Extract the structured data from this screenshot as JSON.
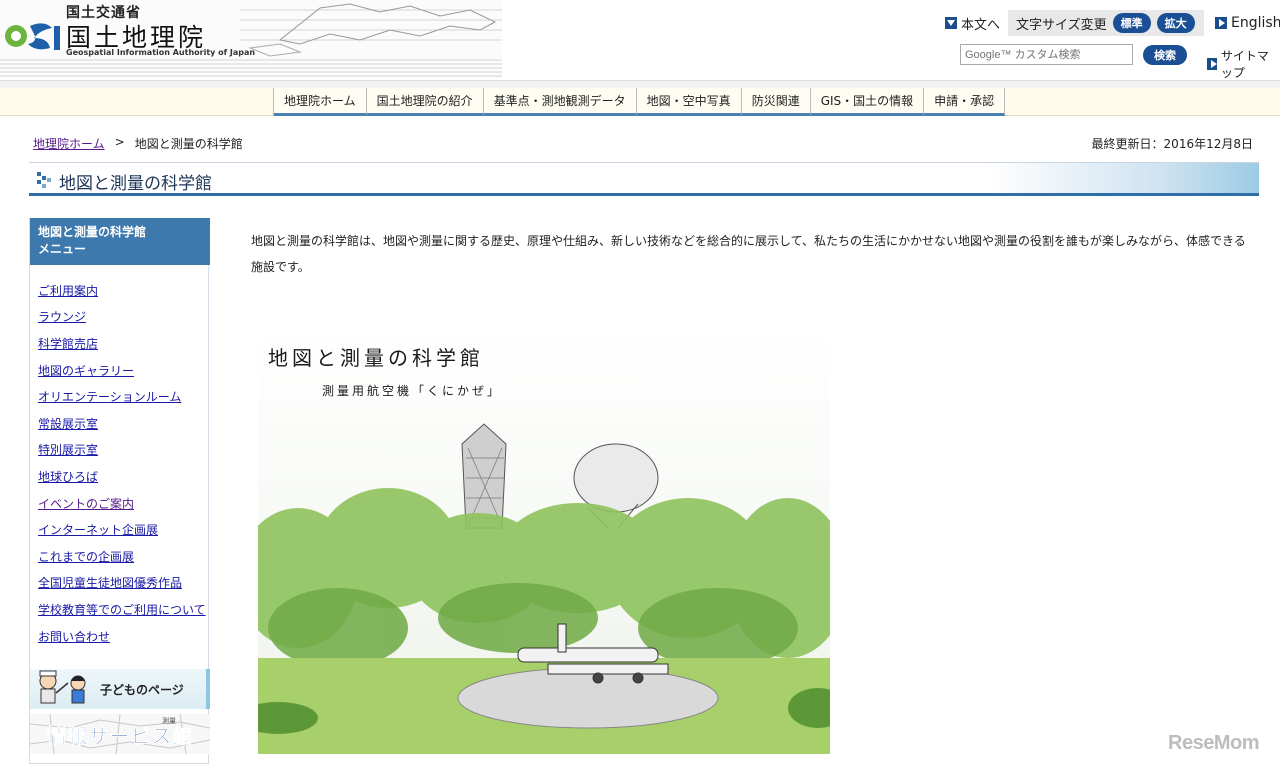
{
  "header": {
    "ministry": "国土交通省",
    "org_name": "国土地理院",
    "org_name_en": "Geospatial Information Authority of Japan",
    "skip_link": "本文へ",
    "font_size_label": "文字サイズ変更",
    "font_standard": "標準",
    "font_large": "拡大",
    "english": "English",
    "search_placeholder": "Google™ カスタム検索",
    "search_button": "検索",
    "sitemap": "サイトマップ"
  },
  "global_nav": [
    {
      "label": "地理院ホーム"
    },
    {
      "label": "国土地理院の紹介"
    },
    {
      "label": "基準点・測地観測データ"
    },
    {
      "label": "地図・空中写真"
    },
    {
      "label": "防災関連"
    },
    {
      "label": "GIS・国土の情報"
    },
    {
      "label": "申請・承認"
    }
  ],
  "breadcrumb": {
    "home": "地理院ホーム",
    "separator": ">",
    "current": "地図と測量の科学館"
  },
  "updated": "最終更新日：2016年12月8日",
  "page_title": "地図と測量の科学館",
  "sidebar": {
    "title": "地図と測量の科学館",
    "subtitle": "メニュー",
    "items": [
      {
        "label": "ご利用案内"
      },
      {
        "label": "ラウンジ"
      },
      {
        "label": "科学館売店"
      },
      {
        "label": "地図のギャラリー"
      },
      {
        "label": "オリエンテーションルーム"
      },
      {
        "label": "常設展示室"
      },
      {
        "label": "特別展示室"
      },
      {
        "label": "地球ひろば"
      },
      {
        "label": "イベントのご案内"
      },
      {
        "label": "インターネット企画展"
      },
      {
        "label": "これまでの企画展"
      },
      {
        "label": "全国児童生徒地図優秀作品"
      },
      {
        "label": "学校教育等でのご利用について"
      },
      {
        "label": "お問い合わせ"
      }
    ],
    "kids_banner": "子どものページ",
    "info_banner": "情報サービス館",
    "info_banner_small": "測量"
  },
  "intro_text": "地図と測量の科学館は、地図や測量に関する歴史、原理や仕組み、新しい技術などを総合的に展示して、私たちの生活にかかせない地図や測量の役割を誰もが楽しみながら、体感できる施設です。",
  "illustration": {
    "title": "地図と測量の科学館",
    "subtitle": "測量用航空機「くにかぜ」"
  },
  "watermark": "ReseMom",
  "colors": {
    "nav_blue": "#1a4f95",
    "sidebar_head": "#3e79ad",
    "nav_bg": "#fffbeb",
    "link": "#1a1aa6"
  }
}
